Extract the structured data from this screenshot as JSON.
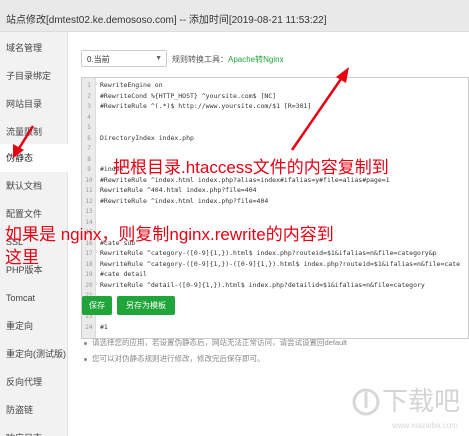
{
  "window": {
    "title": "站点修改[dmtest02.ke.demososo.com] -- 添加时间[2019-08-21 11:53:22]"
  },
  "sidebar": {
    "items": [
      {
        "label": "域名管理"
      },
      {
        "label": "子目录绑定"
      },
      {
        "label": "网站目录"
      },
      {
        "label": "流量限制"
      },
      {
        "label": "伪静态"
      },
      {
        "label": "默认文档"
      },
      {
        "label": "配置文件"
      },
      {
        "label": "SSL"
      },
      {
        "label": "PHP版本"
      },
      {
        "label": "Tomcat"
      },
      {
        "label": "重定向"
      },
      {
        "label": "重定向(测试版)"
      },
      {
        "label": "反向代理"
      },
      {
        "label": "防盗链"
      },
      {
        "label": "响应日志"
      }
    ],
    "active_index": 4
  },
  "toolbar": {
    "select_value": "0.当前",
    "rule_label": "规则转换工具：",
    "rule_link": "Apache转Nginx"
  },
  "editor": {
    "line_numbers": [
      "1",
      "2",
      "3",
      "4",
      "5",
      "6",
      "7",
      "8",
      "9",
      "10",
      "11",
      "12",
      "13",
      "14",
      "15",
      "16",
      "17",
      "18",
      "19",
      "20",
      "21",
      "22",
      "23",
      "24"
    ],
    "lines": [
      " RewriteEngine on",
      "#RewriteCond %{HTTP_HOST} ^yoursite.com$ [NC]",
      "#RewriteRule ^(.*)$ http://www.yoursite.com/$1 [R=301]",
      "",
      "",
      "DirectoryIndex index.php",
      "",
      "",
      "#index",
      "#RewriteRule ^index.html index.php?alias=index#ifalias=y#file=alias#page=1",
      "RewriteRule ^404.html index.php?file=404",
      "#RewriteRule ^index.html index.php?file=404",
      "",
      "",
      "",
      "#cate sub",
      "RewriteRule ^category-([0-9]{1,}).html$ index.php?routeid=$1&ifalias=n&file=category&p",
      "RewriteRule ^category-([0-9]{1,})-([0-9]{1,}).html$ index.php?routeid=$1&ifalias=n&file=cate",
      "#cate detail",
      "RewriteRule ^detail-([0-9]{1,}).html$ index.php?detailid=$1&ifalias=n&file=category",
      "",
      "",
      "",
      "#1"
    ]
  },
  "annotations": {
    "line1": "把根目录.htaccess文件的内容复制到",
    "line2": "如果是 nginx，则复制nginx.rewrite的内容到",
    "line3": "这里"
  },
  "buttons": {
    "save": "保存",
    "save_as_template": "另存为模板"
  },
  "notes": [
    "请选择您的应用，若设置伪静态后，网站无法正常访问，请尝试设置回default",
    "您可以对伪静态规则进行修改，修改完后保存即可。"
  ],
  "watermark": {
    "text": "下载吧",
    "url": "www.xiazaiba.com"
  },
  "colors": {
    "accent_green": "#20a53a",
    "annotation_red": "#e60012"
  }
}
